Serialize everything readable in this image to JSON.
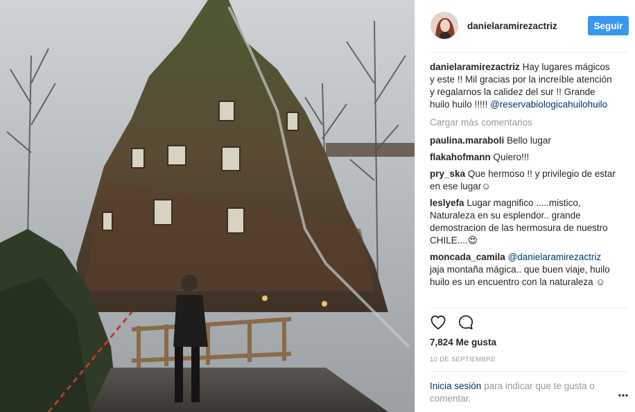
{
  "post": {
    "username": "danielaramirezactriz",
    "follow_label": "Seguir",
    "caption": {
      "user": "danielaramirezactriz",
      "text": "Hay lugares mágicos y este !! Mil gracias por la increíble atención y regalarnos la calidez del sur !! Grande huilo huilo !!!!!",
      "mention": "@reservabiologicahuilohuilo"
    },
    "load_more": "Cargar más comentarios",
    "comments": [
      {
        "user": "paulina.maraboli",
        "text": "Bello lugar"
      },
      {
        "user": "flakahofmann",
        "text": "Quiero!!!"
      },
      {
        "user": "pry_ska",
        "text": "Que hermoso !! y privilegio de estar en ese lugar☺"
      },
      {
        "user": "leslyefa",
        "text": "Lugar magnifico .....mistico, Naturaleza en su esplendor.. grande demostracion de las hermosura de nuestro CHILE....😍"
      },
      {
        "user": "moncada_camila",
        "mention": "@danielaramirezactriz",
        "text": "jaja montaña mágica.. que buen viaje, huilo huilo es un encuentro con la naturaleza ☺"
      }
    ],
    "likes": "7,824 Me gusta",
    "date": "10 DE SEPTIEMBRE",
    "login_link": "Inicia sesión",
    "login_text": "para indicar que te gusta o comentar."
  }
}
